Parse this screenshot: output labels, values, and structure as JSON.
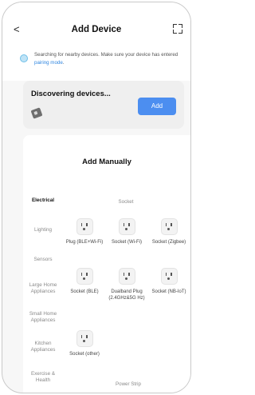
{
  "header": {
    "back": "<",
    "title": "Add Device"
  },
  "hint": {
    "text": "Searching for nearby devices. Make sure your device has entered ",
    "link": "pairing mode",
    "end": "."
  },
  "discover": {
    "title": "Discovering devices...",
    "button": "Add"
  },
  "manual": {
    "title": "Add Manually",
    "categories": [
      "Electrical",
      "Lighting",
      "Sensors",
      "Large Home Appliances",
      "Small Home Appliances",
      "Kitchen Appliances",
      "Exercise & Health"
    ],
    "section_socket": "Socket",
    "section_power_strip": "Power Strip",
    "devices": [
      {
        "label": "Plug (BLE+Wi-Fi)"
      },
      {
        "label": "Socket (Wi-Fi)"
      },
      {
        "label": "Socket (Zigbee)"
      },
      {
        "label": "Socket (BLE)"
      },
      {
        "label": "Dualband Plug (2.4GHz&5G Hz)"
      },
      {
        "label": "Socket (NB-IoT)"
      },
      {
        "label": "Socket (other)"
      }
    ]
  },
  "colors": {
    "accent": "#4c8ef0",
    "link": "#2f86e0"
  }
}
